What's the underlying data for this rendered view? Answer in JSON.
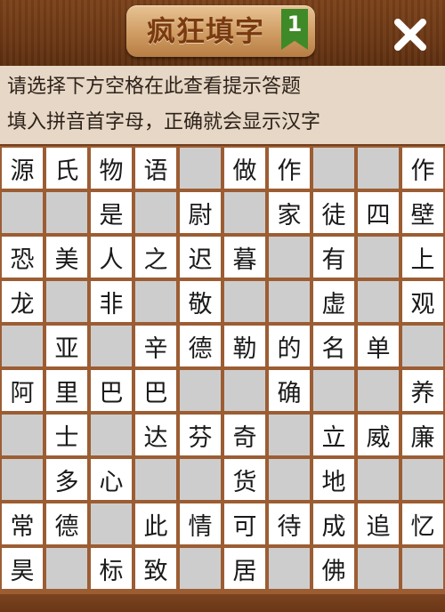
{
  "header": {
    "title": "疯狂填字",
    "level": "1"
  },
  "hint": {
    "line1": "请选择下方空格在此查看提示答题",
    "line2": "填入拼音首字母，正确就会显示汉字"
  },
  "colors": {
    "wood_dark": "#6b3714",
    "title_badge": "#cf9c63",
    "title_text": "#7a3a10",
    "level_flag": "#3f8a28",
    "hint_bg": "#e6d7c6",
    "grid_border": "#9c5d33",
    "cell_white": "#ffffff",
    "cell_gray": "#cdcdcd"
  },
  "grid": [
    [
      "源",
      "氏",
      "物",
      "语",
      null,
      "做",
      "作",
      null,
      null,
      "作"
    ],
    [
      null,
      null,
      "是",
      null,
      "尉",
      null,
      "家",
      "徒",
      "四",
      "壁"
    ],
    [
      "恐",
      "美",
      "人",
      "之",
      "迟",
      "暮",
      null,
      "有",
      null,
      "上"
    ],
    [
      "龙",
      null,
      "非",
      null,
      "敬",
      null,
      null,
      "虚",
      null,
      "观"
    ],
    [
      null,
      "亚",
      null,
      "辛",
      "德",
      "勒",
      "的",
      "名",
      "单",
      null
    ],
    [
      "阿",
      "里",
      "巴",
      "巴",
      null,
      null,
      "确",
      null,
      null,
      "养"
    ],
    [
      null,
      "士",
      null,
      "达",
      "芬",
      "奇",
      null,
      "立",
      "威",
      "廉"
    ],
    [
      null,
      "多",
      "心",
      null,
      null,
      "货",
      null,
      "地",
      null,
      null
    ],
    [
      "常",
      "德",
      null,
      "此",
      "情",
      "可",
      "待",
      "成",
      "追",
      "忆"
    ],
    [
      "昊",
      null,
      "标",
      "致",
      null,
      "居",
      null,
      "佛",
      null,
      null
    ]
  ]
}
